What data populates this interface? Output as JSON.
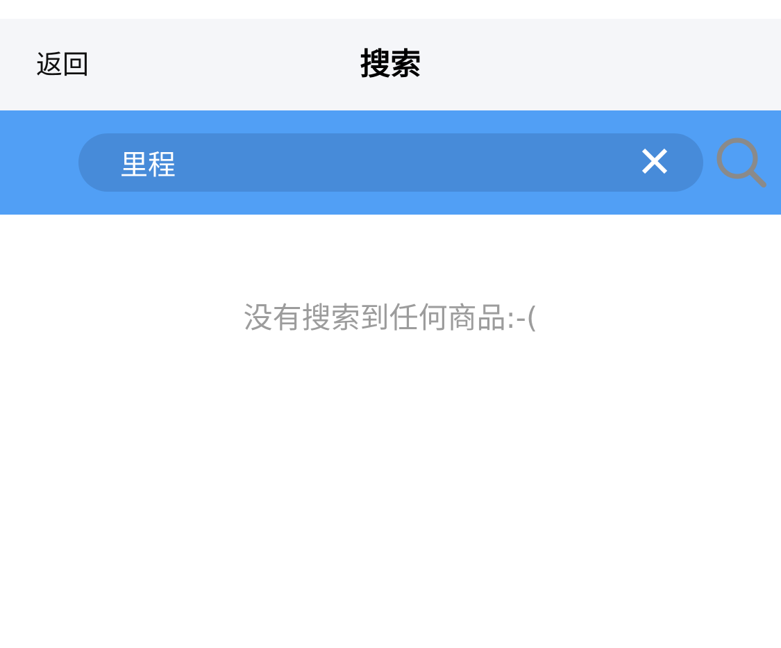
{
  "navbar": {
    "back_label": "返回",
    "title": "搜索"
  },
  "search": {
    "value": "里程",
    "clear_icon": "close-icon",
    "search_icon": "search-icon"
  },
  "results": {
    "empty_message": "没有搜索到任何商品:-("
  },
  "colors": {
    "navbar_bg": "#f5f6f9",
    "search_bar_bg": "#519ff5",
    "search_field_bg": "#478bd9",
    "empty_text": "#9c9c9c",
    "search_icon": "#8a8a8a"
  }
}
